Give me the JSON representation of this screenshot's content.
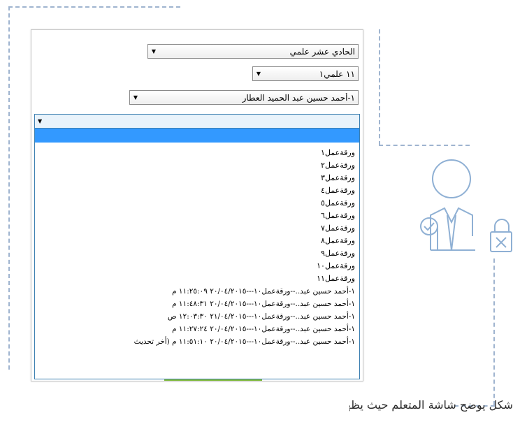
{
  "selects": {
    "grade": "الحادي عشر علمي",
    "class": "١١ علمي١",
    "student": "١-أحمد حسين عبد الحميد العطار"
  },
  "list": {
    "items": [
      "ورقةعمل١",
      "ورقةعمل٢",
      "ورقةعمل٣",
      "ورقةعمل٤",
      "ورقةعمل٥",
      "ورقةعمل٦",
      "ورقةعمل٧",
      "ورقةعمل٨",
      "ورقةعمل٩",
      "ورقةعمل١٠",
      "ورقةعمل١١"
    ],
    "records": [
      "١-أحمد حسين عبد..--ورقةعمل١٠---٢٠/٠٤/٢٠١٥ ١١:٢٥:٠٩ م",
      "١-أحمد حسين عبد..--ورقةعمل١٠---٢٠/٠٤/٢٠١٥ ١١:٤٨:٣١ م",
      "١-أحمد حسين عبد..--ورقةعمل١٠---٢١/٠٤/٢٠١٥ ١٢:٠٣:٣٠ ص",
      "١-أحمد حسين عبد..--ورقةعمل١٠---٢٠/٠٤/٢٠١٥ ١١:٢٧:٢٤ م",
      "١-أحمد حسين عبد..--ورقةعمل١٠---٢٠/٠٤/٢٠١٥ ١١:٥١:١٠ م (أخر تحديث"
    ]
  },
  "caption": "شكل يوضح شاشة المتعلم حيث يظهر شغله السابق ويمكن له التعديل عليه",
  "colors": {
    "dash": "#9fb4cf",
    "selection": "#3399ff",
    "icon": "#8fb0d4"
  },
  "icons": [
    "person-with-tie-icon",
    "check-icon",
    "lock-icon"
  ]
}
